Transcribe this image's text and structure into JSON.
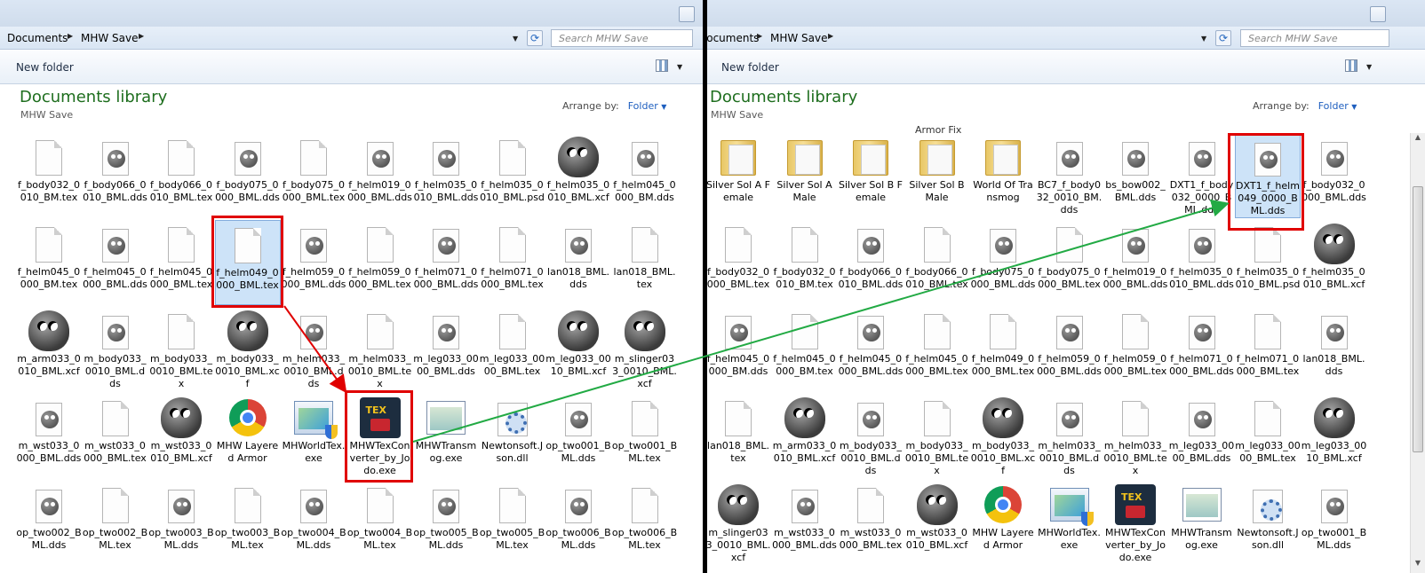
{
  "left": {
    "crumbs": [
      "Documents",
      "MHW Save"
    ],
    "search_placeholder": "Search MHW Save",
    "new_folder": "New folder",
    "library_title": "Documents library",
    "library_sub": "MHW Save",
    "arrange_label": "Arrange by:",
    "arrange_value": "Folder",
    "items": [
      [
        "f_body032_0010_BM.tex",
        "doc"
      ],
      [
        "f_body066_0010_BML.dds",
        "gimp"
      ],
      [
        "f_body066_0010_BML.tex",
        "doc"
      ],
      [
        "f_body075_0000_BML.dds",
        "gimp"
      ],
      [
        "f_body075_0000_BML.tex",
        "doc"
      ],
      [
        "f_helm019_0000_BML.dds",
        "gimp"
      ],
      [
        "f_helm035_0010_BML.dds",
        "gimp"
      ],
      [
        "f_helm035_0010_BML.psd",
        "doc"
      ],
      [
        "f_helm035_0010_BML.xcf",
        "gimpbig"
      ],
      [
        "f_helm045_0000_BM.dds",
        "gimp"
      ],
      [
        "f_helm045_0000_BM.tex",
        "doc"
      ],
      [
        "f_helm045_0000_BML.dds",
        "gimp"
      ],
      [
        "f_helm045_0000_BML.tex",
        "doc"
      ],
      [
        "f_helm049_0000_BML.tex",
        "doc"
      ],
      [
        "f_helm059_0000_BML.dds",
        "gimp"
      ],
      [
        "f_helm059_0000_BML.tex",
        "doc"
      ],
      [
        "f_helm071_0000_BML.dds",
        "gimp"
      ],
      [
        "f_helm071_0000_BML.tex",
        "doc"
      ],
      [
        "lan018_BML.dds",
        "gimp"
      ],
      [
        "lan018_BML.tex",
        "doc"
      ],
      [
        "m_arm033_0010_BML.xcf",
        "gimpbig"
      ],
      [
        "m_body033_0010_BML.dds",
        "gimp"
      ],
      [
        "m_body033_0010_BML.tex",
        "doc"
      ],
      [
        "m_body033_0010_BML.xcf",
        "gimpbig"
      ],
      [
        "m_helm033_0010_BML.dds",
        "gimp"
      ],
      [
        "m_helm033_0010_BML.tex",
        "doc"
      ],
      [
        "m_leg033_0000_BML.dds",
        "gimp"
      ],
      [
        "m_leg033_0000_BML.tex",
        "doc"
      ],
      [
        "m_leg033_0010_BML.xcf",
        "gimpbig"
      ],
      [
        "m_slinger033_0010_BML.xcf",
        "gimpbig"
      ],
      [
        "m_wst033_0000_BML.dds",
        "gimp"
      ],
      [
        "m_wst033_0000_BML.tex",
        "doc"
      ],
      [
        "m_wst033_0010_BML.xcf",
        "gimpbig"
      ],
      [
        "MHW Layered Armor",
        "chrome"
      ],
      [
        "MHWorldTex.exe",
        "exe"
      ],
      [
        "MHWTexConverter_by_Jodo.exe",
        "tex"
      ],
      [
        "MHWTransmog.exe",
        "win"
      ],
      [
        "Newtonsoft.Json.dll",
        "gear"
      ],
      [
        "op_two001_BML.dds",
        "gimp"
      ],
      [
        "op_two001_BML.tex",
        "doc"
      ],
      [
        "op_two002_BML.dds",
        "gimp"
      ],
      [
        "op_two002_BML.tex",
        "doc"
      ],
      [
        "op_two003_BML.dds",
        "gimp"
      ],
      [
        "op_two003_BML.tex",
        "doc"
      ],
      [
        "op_two004_BML.dds",
        "gimp"
      ],
      [
        "op_two004_BML.tex",
        "doc"
      ],
      [
        "op_two005_BML.dds",
        "gimp"
      ],
      [
        "op_two005_BML.tex",
        "doc"
      ],
      [
        "op_two006_BML.dds",
        "gimp"
      ],
      [
        "op_two006_BML.tex",
        "doc"
      ]
    ]
  },
  "right": {
    "crumbs": [
      "Documents",
      "MHW Save"
    ],
    "search_placeholder": "Search MHW Save",
    "new_folder": "New folder",
    "library_title": "Documents library",
    "library_sub": "MHW Save",
    "arrange_label": "Arrange by:",
    "arrange_value": "Folder",
    "partial_label": "Armor Fix",
    "items": [
      [
        "Silver Sol A Female",
        "folder"
      ],
      [
        "Silver Sol A Male",
        "folder"
      ],
      [
        "Silver Sol B Female",
        "folder"
      ],
      [
        "Silver Sol B Male",
        "folder"
      ],
      [
        "World Of Transmog",
        "folder"
      ],
      [
        "BC7_f_body032_0010_BM.dds",
        "gimp"
      ],
      [
        "bs_bow002_BML.dds",
        "gimp"
      ],
      [
        "DXT1_f_body032_0000_BML.dds",
        "gimp"
      ],
      [
        "DXT1_f_helm049_0000_BML.dds",
        "gimp"
      ],
      [
        "f_body032_0000_BML.dds",
        "gimp"
      ],
      [
        "f_body032_0000_BML.tex",
        "doc"
      ],
      [
        "f_body032_0010_BM.tex",
        "doc"
      ],
      [
        "f_body066_0010_BML.dds",
        "gimp"
      ],
      [
        "f_body066_0010_BML.tex",
        "doc"
      ],
      [
        "f_body075_0000_BML.dds",
        "gimp"
      ],
      [
        "f_body075_0000_BML.tex",
        "doc"
      ],
      [
        "f_helm019_0000_BML.dds",
        "gimp"
      ],
      [
        "f_helm035_0010_BML.dds",
        "gimp"
      ],
      [
        "f_helm035_0010_BML.psd",
        "doc"
      ],
      [
        "f_helm035_0010_BML.xcf",
        "gimpbig"
      ],
      [
        "f_helm045_0000_BM.dds",
        "gimp"
      ],
      [
        "f_helm045_0000_BM.tex",
        "doc"
      ],
      [
        "f_helm045_0000_BML.dds",
        "gimp"
      ],
      [
        "f_helm045_0000_BML.tex",
        "doc"
      ],
      [
        "f_helm049_0000_BML.tex",
        "doc"
      ],
      [
        "f_helm059_0000_BML.dds",
        "gimp"
      ],
      [
        "f_helm059_0000_BML.tex",
        "doc"
      ],
      [
        "f_helm071_0000_BML.dds",
        "gimp"
      ],
      [
        "f_helm071_0000_BML.tex",
        "doc"
      ],
      [
        "lan018_BML.dds",
        "gimp"
      ],
      [
        "lan018_BML.tex",
        "doc"
      ],
      [
        "m_arm033_0010_BML.xcf",
        "gimpbig"
      ],
      [
        "m_body033_0010_BML.dds",
        "gimp"
      ],
      [
        "m_body033_0010_BML.tex",
        "doc"
      ],
      [
        "m_body033_0010_BML.xcf",
        "gimpbig"
      ],
      [
        "m_helm033_0010_BML.dds",
        "gimp"
      ],
      [
        "m_helm033_0010_BML.tex",
        "doc"
      ],
      [
        "m_leg033_0000_BML.dds",
        "gimp"
      ],
      [
        "m_leg033_0000_BML.tex",
        "doc"
      ],
      [
        "m_leg033_0010_BML.xcf",
        "gimpbig"
      ],
      [
        "m_slinger033_0010_BML.xcf",
        "gimpbig"
      ],
      [
        "m_wst033_0000_BML.dds",
        "gimp"
      ],
      [
        "m_wst033_0000_BML.tex",
        "doc"
      ],
      [
        "m_wst033_0010_BML.xcf",
        "gimpbig"
      ],
      [
        "MHW Layered Armor",
        "chrome"
      ],
      [
        "MHWorldTex.exe",
        "exe"
      ],
      [
        "MHWTexConverter_by_Jodo.exe",
        "tex"
      ],
      [
        "MHWTransmog.exe",
        "win"
      ],
      [
        "Newtonsoft.Json.dll",
        "gear"
      ],
      [
        "op_two001_BML.dds",
        "gimp"
      ]
    ]
  },
  "icon_names": {
    "doc": "blank-file-icon",
    "gimp": "gimp-image-icon",
    "gimpbig": "gimp-xcf-icon",
    "folder": "folder-icon",
    "chrome": "chrome-shortcut-icon",
    "exe": "application-exe-icon",
    "tex": "mhw-tex-converter-icon",
    "win": "application-window-icon",
    "gear": "dll-gear-icon"
  },
  "colors": {
    "highlight": "#e00000",
    "arrow_red": "#e00000",
    "arrow_green": "#22aa44",
    "title_green": "#1e6e1e"
  },
  "selected": {
    "left": "f_helm049_0000_BML.tex",
    "right": "DXT1_f_helm049_0000_BML.dds"
  }
}
